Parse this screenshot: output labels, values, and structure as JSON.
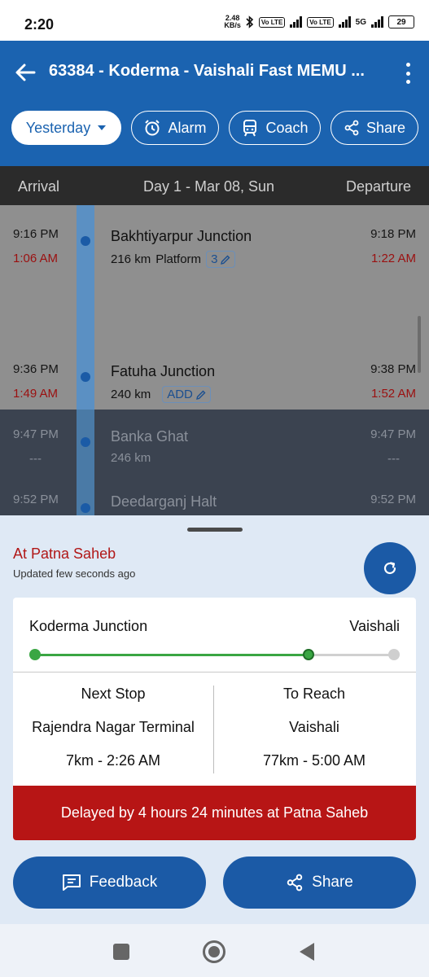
{
  "status": {
    "time": "2:20",
    "speed_value": "2.48",
    "speed_unit": "KB/s",
    "volte1": "Vo LTE",
    "volte2": "Vo LTE",
    "network": "5G",
    "battery": "29"
  },
  "appbar": {
    "title": "63384 - Koderma - Vaishali Fast MEMU ...",
    "chips": {
      "date": "Yesterday",
      "alarm": "Alarm",
      "coach": "Coach",
      "share": "Share"
    }
  },
  "day_header": {
    "arrival": "Arrival",
    "day": "Day 1 - Mar 08, Sun",
    "departure": "Departure"
  },
  "stations": [
    {
      "name": "Bakhtiyarpur Junction",
      "sched_arr": "9:16 PM",
      "act_arr": "1:06 AM",
      "sched_dep": "9:18 PM",
      "act_dep": "1:22 AM",
      "distance": "216 km",
      "platform_label": "Platform",
      "platform": "3"
    },
    {
      "name": "Fatuha Junction",
      "sched_arr": "9:36 PM",
      "act_arr": "1:49 AM",
      "sched_dep": "9:38 PM",
      "act_dep": "1:52 AM",
      "distance": "240 km",
      "platform": "ADD"
    },
    {
      "name": "Banka Ghat",
      "sched_arr": "9:47 PM",
      "act_arr": "---",
      "sched_dep": "9:47 PM",
      "act_dep": "---",
      "distance": "246 km"
    },
    {
      "name": "Deedarganj Halt",
      "sched_arr": "9:52 PM",
      "sched_dep": "9:52 PM"
    }
  ],
  "live": {
    "location": "At Patna Saheb",
    "updated": "Updated few seconds ago",
    "origin": "Koderma Junction",
    "destination": "Vaishali",
    "progress_fraction": 0.76,
    "next_stop_label": "Next Stop",
    "next_stop_name": "Rajendra Nagar Terminal",
    "next_stop_info": "7km - 2:26 AM",
    "to_reach_label": "To Reach",
    "to_reach_name": "Vaishali",
    "to_reach_info": "77km - 5:00 AM",
    "delay": "Delayed by 4 hours 24 minutes at Patna Saheb"
  },
  "actions": {
    "feedback": "Feedback",
    "share": "Share"
  },
  "colors": {
    "primary": "#1b63b0",
    "late_red": "#9b1010",
    "delay_bg": "#b71515",
    "progress_green": "#3aa643"
  }
}
